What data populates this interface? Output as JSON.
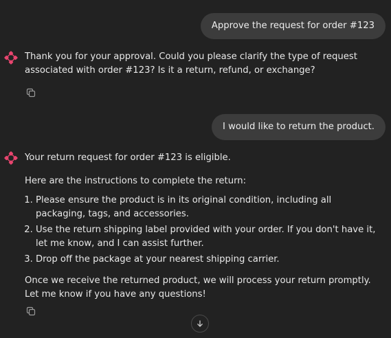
{
  "messages": {
    "user_1": "Approve the request for order #123",
    "assistant_1": "Thank you for your approval. Could you please clarify the type of request associated with order #123? Is it a return, refund, or exchange?",
    "user_2": "I would like to return the product.",
    "assistant_2": {
      "line_1": "Your return request for order #123 is eligible.",
      "line_2": "Here are the instructions to complete the return:",
      "steps": [
        "Please ensure the product is in its original condition, including all packaging, tags, and accessories.",
        "Use the return shipping label provided with your order. If you don't have it, let me know, and I can assist further.",
        "Drop off the package at your nearest shipping carrier."
      ],
      "closing": "Once we receive the returned product, we will process your return promptly. Let me know if you have any questions!"
    }
  },
  "icons": {
    "assistant": "assistant-logo-icon",
    "copy": "copy-icon",
    "scroll": "arrow-down-icon"
  },
  "colors": {
    "background": "#222222",
    "user_bubble": "#3c3c3c",
    "assistant_logo": "#e8456f",
    "text": "#e8e8e8",
    "icon_muted": "#9a9a9a"
  }
}
